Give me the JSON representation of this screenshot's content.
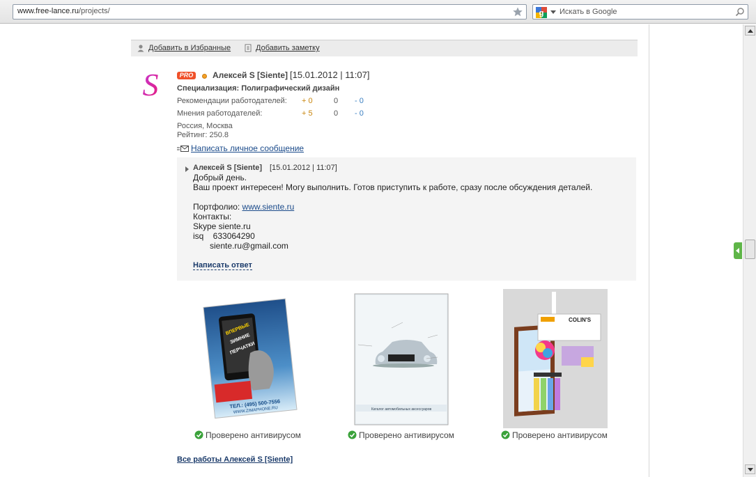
{
  "browser": {
    "url_host": "www.free-lance.ru",
    "url_path": "/projects/",
    "search_placeholder": "Искать в Google"
  },
  "topbar": {
    "favorites_label": "Добавить в Избранные",
    "note_label": "Добавить заметку"
  },
  "profile": {
    "avatar_letter": "S",
    "pro_badge": "PRO",
    "name": "Алексей S [Siente]",
    "date": "[15.01.2012 | 11:07]",
    "specialization": "Специализация: Полиграфический дизайн",
    "recommendations": {
      "label": "Рекомендации работодателей:",
      "pos": "+ 0",
      "zero": "0",
      "neg": "- 0"
    },
    "opinions": {
      "label": "Мнения работодателей:",
      "pos": "+ 5",
      "zero": "0",
      "neg": "- 0"
    },
    "location": "Россия, Москва",
    "rating": "Рейтинг: 250.8",
    "message_link": "Написать личное сообщение"
  },
  "reply": {
    "author": "Алексей S [Siente]",
    "date": "[15.01.2012 | 11:07]",
    "greeting": "Добрый день.",
    "body": "Ваш проект интересен! Могу выполнить. Готов приступить к работе, сразу после обсуждения деталей.",
    "portfolio_label": "Портфолио:",
    "portfolio_url": "www.siente.ru",
    "contacts_label": "Контакты:",
    "skype": "Skype siente.ru",
    "icq": "isq    633064290",
    "email": "siente.ru@gmail.com",
    "answer_label": "Написать ответ"
  },
  "works": [
    {
      "verified": "Проверено антивирусом",
      "poster_text": "ТЕЛ.: (495) 500-7556",
      "poster_url": "WWW.ZIMAPHONE.RU"
    },
    {
      "verified": "Проверено антивирусом",
      "caption": "Каталог автомобильных аксессуаров"
    },
    {
      "verified": "Проверено антивирусом",
      "brand": "COLIN'S"
    }
  ],
  "all_works_label": "Все работы Алексей S [Siente]",
  "colors": {
    "link": "#1a4a8a",
    "pro_badge": "#f0512a",
    "positive": "#c9860e",
    "negative": "#3a7fc1",
    "verified_green": "#3aa23a"
  }
}
